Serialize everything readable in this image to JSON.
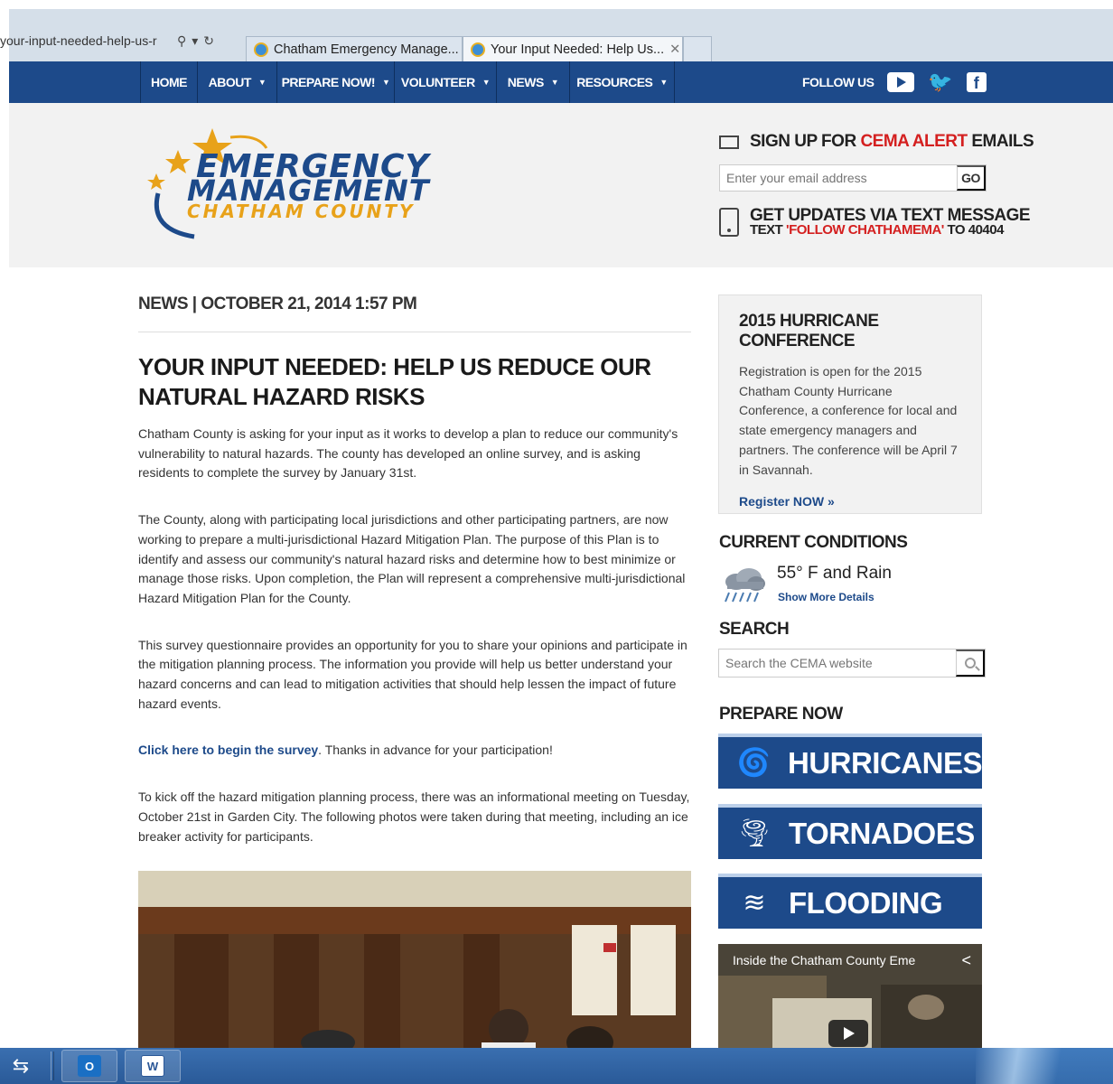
{
  "browser": {
    "address_text": "your-input-needed-help-us-r",
    "tabs": [
      {
        "label": "Chatham Emergency Manage..."
      },
      {
        "label": "Your Input Needed: Help Us..."
      }
    ],
    "tab_close_icon": "close-icon"
  },
  "nav": {
    "items": [
      {
        "label": "HOME",
        "has_caret": false
      },
      {
        "label": "ABOUT",
        "has_caret": true
      },
      {
        "label": "PREPARE NOW!",
        "has_caret": true
      },
      {
        "label": "VOLUNTEER",
        "has_caret": true
      },
      {
        "label": "NEWS",
        "has_caret": true
      },
      {
        "label": "RESOURCES",
        "has_caret": true
      }
    ],
    "follow_label": "FOLLOW US",
    "social_icons": [
      "youtube-icon",
      "twitter-icon",
      "facebook-icon"
    ],
    "color": "#1d4a8a"
  },
  "header": {
    "logo": {
      "line1": "EMERGENCY",
      "line2": "MANAGEMENT",
      "line3": "CHATHAM COUNTY"
    },
    "signup": {
      "prefix": "SIGN UP FOR ",
      "highlight": "CEMA ALERT",
      "suffix": " EMAILS",
      "email_placeholder": "Enter your email address",
      "go_label": "GO"
    },
    "sms": {
      "line1": "GET UPDATES VIA TEXT MESSAGE",
      "line2_prefix": "TEXT ",
      "line2_highlight": "'FOLLOW CHATHAMEMA'",
      "line2_suffix": " TO 40404"
    },
    "accent_red": "#d42020"
  },
  "article": {
    "meta": "NEWS | OCTOBER 21, 2014 1:57 PM",
    "title": "YOUR INPUT NEEDED: HELP US REDUCE OUR NATURAL HAZARD RISKS",
    "paragraphs": [
      "Chatham County is asking for your input as it works to develop a plan to reduce our community's vulnerability to natural hazards. The county has developed an online survey, and is asking residents to complete the survey by January 31st.",
      "The County, along with participating local jurisdictions and other participating partners, are now working to prepare a multi-jurisdictional Hazard Mitigation Plan. The purpose of this Plan is to identify and assess our community's natural hazard risks and determine how to best minimize or manage those risks. Upon completion, the Plan will represent a comprehensive multi-jurisdictional Hazard Mitigation Plan for the County.",
      "This survey questionnaire provides an opportunity for you to share your opinions and participate in the mitigation planning process. The information you provide will help us better understand your hazard concerns and can lead to mitigation activities that should help lessen the impact of future hazard events."
    ],
    "survey_link": "Click here to begin the survey",
    "survey_suffix": ". Thanks in advance for your participation!",
    "closing": "To kick off the hazard mitigation planning process, there was an informational meeting on Tuesday, October 21st in Garden City. The following photos were taken during that meeting, including an ice breaker activity for participants."
  },
  "sidebar": {
    "conference": {
      "title": "2015 HURRICANE CONFERENCE",
      "body": "Registration is open for the 2015 Chatham County Hurricane Conference, a conference for local and state emergency managers and partners. The conference will be April 7 in Savannah.",
      "link": "Register NOW »"
    },
    "conditions": {
      "title": "CURRENT CONDITIONS",
      "temp": "55° F and Rain",
      "more": "Show More Details",
      "icon": "rain-cloud-icon"
    },
    "search": {
      "title": "SEARCH",
      "placeholder": "Search the CEMA website"
    },
    "prepare": {
      "title": "PREPARE NOW",
      "buttons": [
        {
          "label": "HURRICANES",
          "icon": "hurricane-icon"
        },
        {
          "label": "TORNADOES",
          "icon": "tornado-icon"
        },
        {
          "label": "FLOODING",
          "icon": "flood-icon"
        }
      ]
    },
    "video": {
      "title": "Inside the Chatham County Eme"
    }
  },
  "taskbar": {
    "outlook_label": "O",
    "word_label": "W"
  }
}
